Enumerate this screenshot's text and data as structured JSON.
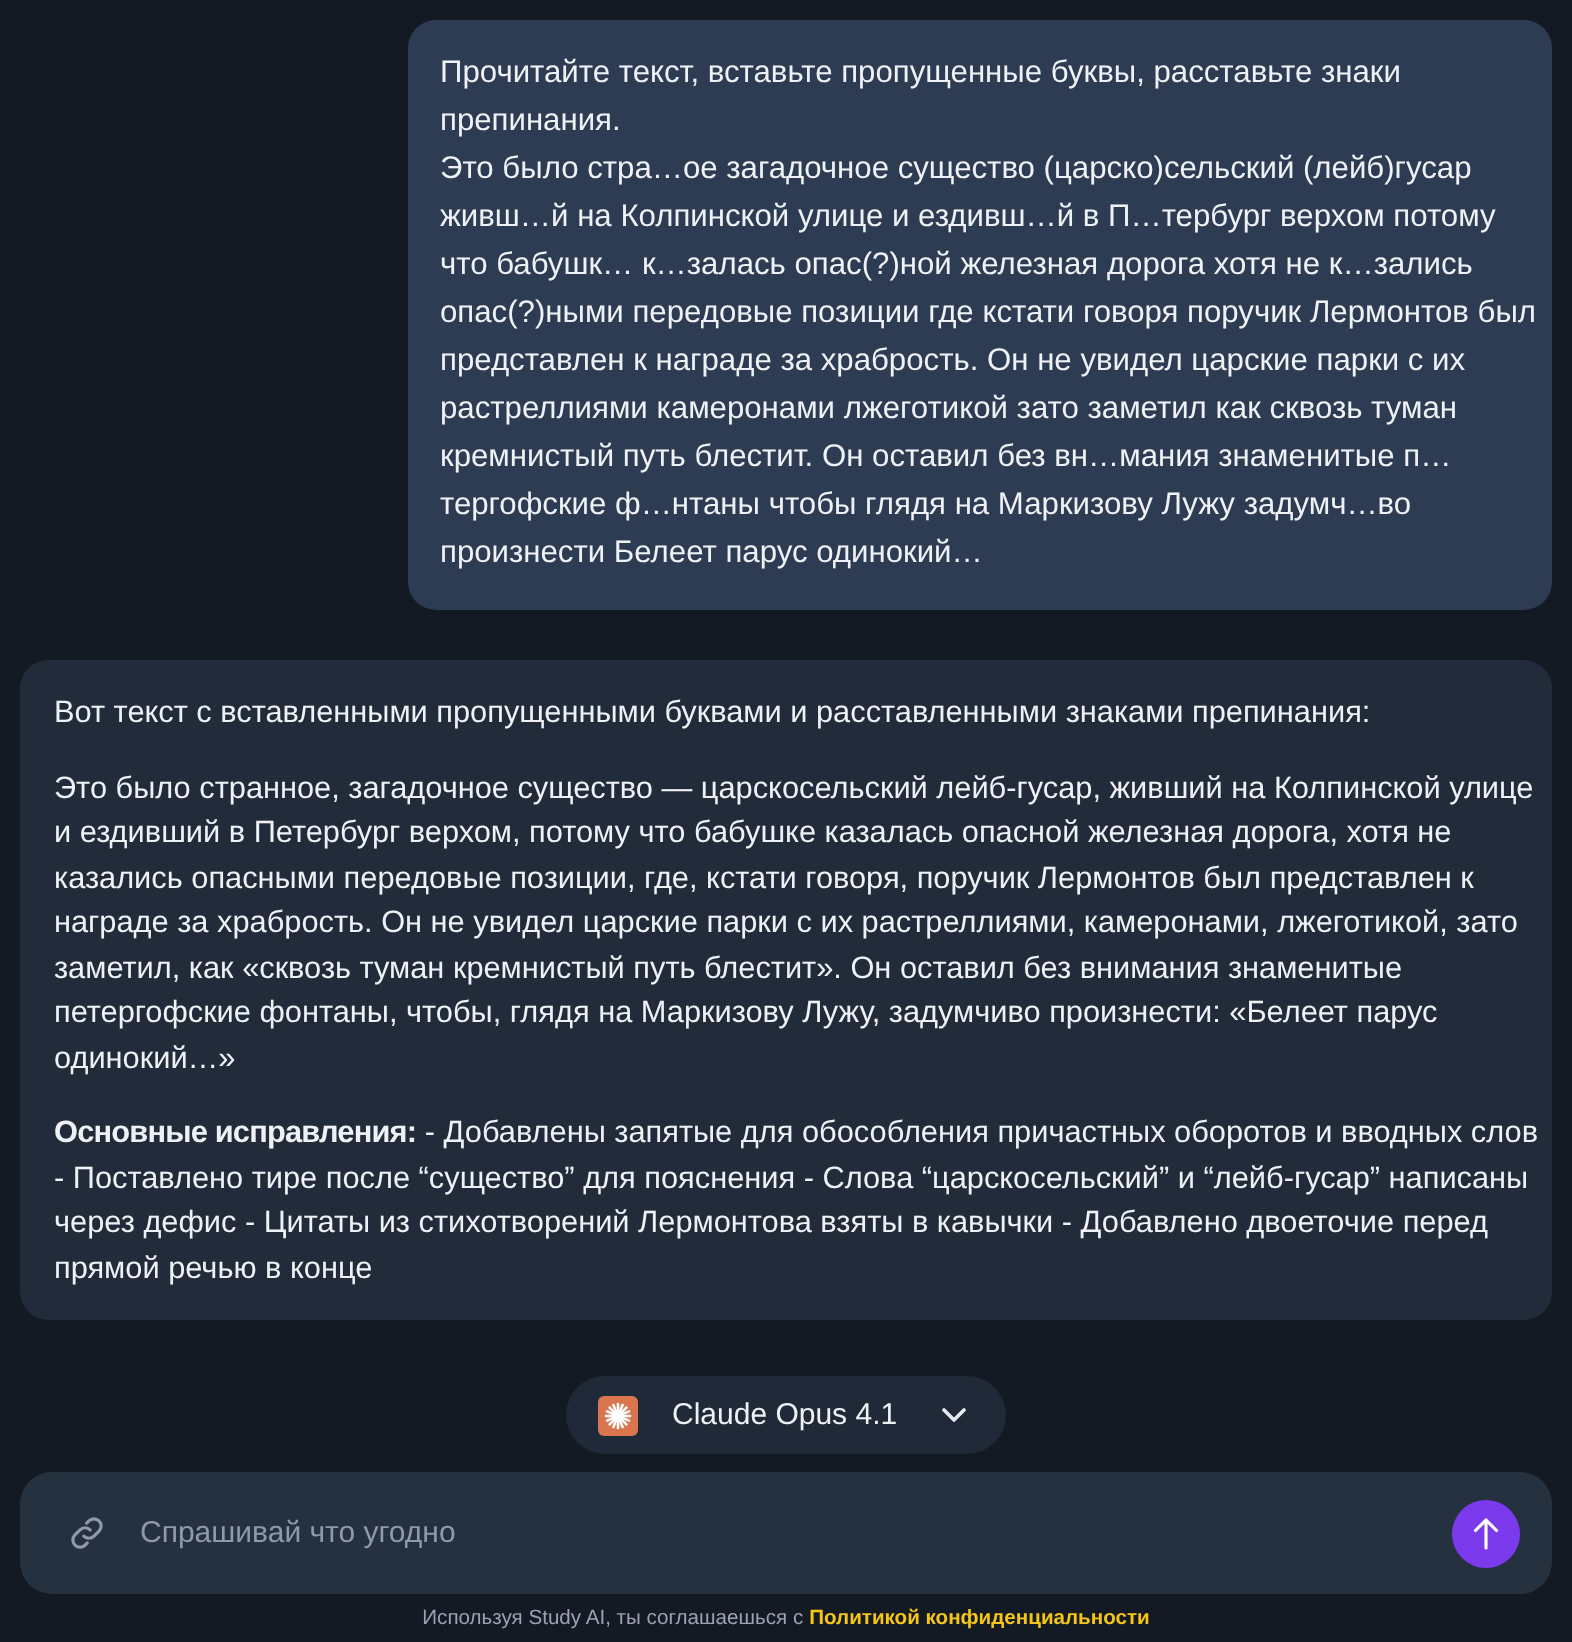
{
  "user_message": {
    "paragraphs": [
      "Прочитайте текст, вставьте пропущенные буквы, расставьте знаки препинания.",
      "Это было стра…ое загадочное существо (царско)сельский (лейб)гусар живш…й на Колпинской улице и ездивш…й в П…тербург верхом потому что бабушк… к…залась опас(?)ной железная дорога хотя не к…зались опас(?)ными передовые позиции где кстати говоря поручик Лермонтов был представлен к награде за храбрость. Он не увидел царские парки с их растреллиями камеронами лжеготикой зато заметил как сквозь туман кремнистый путь блестит. Он оставил без вн…мания знаменитые п…тергофские ф…нтаны чтобы глядя на Маркизову Лужу задумч…во произнести Белеет парус одинокий…"
    ]
  },
  "assistant_message": {
    "paragraphs": [
      "Вот текст с вставленными пропущенными буквами и расставленными знаками препинания:",
      "Это было странное, загадочное существо — царскосельский лейб-гусар, живший на Колпинской улице и ездивший в Петербург верхом, потому что бабушке казалась опасной железная дорога, хотя не казались опасными передовые позиции, где, кстати говоря, поручик Лермонтов был представлен к награде за храбрость. Он не увидел царские парки с их растреллиями, камеронами, лжеготикой, зато заметил, как «сквозь туман кремнистый путь блестит». Он оставил без внимания знаменитые петергофские фонтаны, чтобы, глядя на Маркизову Лужу, задумчиво произнести: «Белеет парус одинокий…»",
      "**Основные исправления:** - Добавлены запятые для обособления причастных оборотов и вводных слов - Поставлено тире после “существо” для пояснения - Слова “царскосельский” и “лейб-гусар” написаны через дефис - Цитаты из стихотворений Лермонтова взяты в кавычки - Добавлено двоеточие перед прямой речью в конце"
    ]
  },
  "model_selector": {
    "label": "Claude Opus 4.1"
  },
  "composer": {
    "placeholder": "Спрашивай что угодно"
  },
  "footer": {
    "text": "Используя Study AI, ты соглашаешься с",
    "link": "Политикой конфиденциальности"
  }
}
